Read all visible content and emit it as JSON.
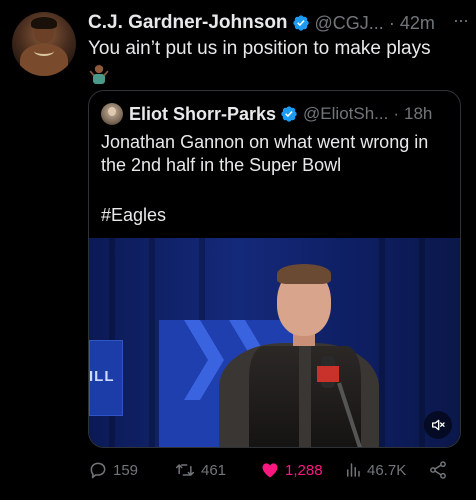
{
  "tweet": {
    "author_name": "C.J. Gardner-Johnson",
    "handle": "@CGJ...",
    "separator": "·",
    "time": "42m",
    "more": "···",
    "text": "You ain’t put us in position to make plays",
    "emoji": "person-shrugging-emoji"
  },
  "quote": {
    "author_name": "Eliot Shorr-Parks",
    "handle": "@EliotSh...",
    "separator": "·",
    "time": "18h",
    "text": "Jonathan Gannon on what went wrong in the 2nd half in the Super Bowl",
    "hashtag": "#Eagles",
    "video": {
      "sign_text": "ILL",
      "muted": true
    }
  },
  "actions": {
    "replies": "159",
    "retweets": "461",
    "likes": "1,288",
    "views": "46.7K"
  },
  "colors": {
    "background": "#000000",
    "text": "#e7e9ea",
    "muted": "#71767b",
    "verified": "#1d9bf0",
    "like": "#f91880",
    "border": "#2f3336"
  }
}
